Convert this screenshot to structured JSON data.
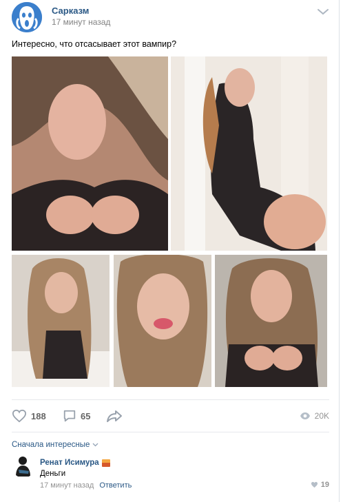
{
  "post": {
    "group_name": "Сарказм",
    "time": "17 минут назад",
    "text": "Интересно, что отсасывает этот вампир?",
    "photos": [
      {
        "name": "photo-1",
        "bg": "#c9a48f"
      },
      {
        "name": "photo-2",
        "bg": "#e6ded6"
      },
      {
        "name": "photo-3",
        "bg": "#d8cfc7"
      },
      {
        "name": "photo-4",
        "bg": "#d9cfc4"
      },
      {
        "name": "photo-5",
        "bg": "#bdb7b0"
      }
    ]
  },
  "actions": {
    "likes": "188",
    "comments": "65",
    "views": "20K"
  },
  "comments": {
    "sort_label": "Сначала интересные",
    "items": [
      {
        "author": "Ренат Исимура",
        "text": "Деньги",
        "time": "17 минут назад",
        "reply_label": "Ответить",
        "likes": "19"
      }
    ]
  },
  "colors": {
    "link": "#2a5885",
    "meta": "#828282",
    "icon": "#99a2ad"
  }
}
